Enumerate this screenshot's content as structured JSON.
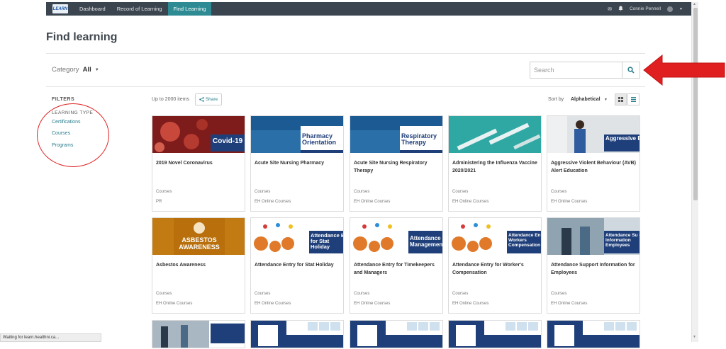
{
  "nav": {
    "logo_text": "LEARN",
    "links": [
      "Dashboard",
      "Record of Learning",
      "Find Learning"
    ],
    "user_name": "Connie Pennell"
  },
  "page": {
    "title": "Find learning"
  },
  "category": {
    "label": "Category",
    "value": "All"
  },
  "search": {
    "placeholder": "Search"
  },
  "filters": {
    "heading": "FILTERS",
    "learning_type_heading": "LEARNING TYPE",
    "types": [
      "Certifications",
      "Courses",
      "Programs"
    ]
  },
  "toolbar": {
    "items_count": "Up to 2000 items",
    "share_label": "Share",
    "sort_label": "Sort by",
    "sort_value": "Alphabetical"
  },
  "cards": [
    {
      "title": "2019 Novel Coronavirus",
      "type": "Courses",
      "source": "PR",
      "banner": "Covid-19"
    },
    {
      "title": "Acute Site Nursing Pharmacy",
      "type": "Courses",
      "source": "EH Online Courses",
      "banner": "Pharmacy Orientation"
    },
    {
      "title": "Acute Site Nursing Respiratory Therapy",
      "type": "Courses",
      "source": "EH Online Courses",
      "banner": "Respiratory Therapy"
    },
    {
      "title": "Administering the Influenza Vaccine 2020/2021",
      "type": "Courses",
      "source": "EH Online Courses",
      "banner": ""
    },
    {
      "title": "Aggressive Violent Behaviour (AVB) Alert Education",
      "type": "Courses",
      "source": "EH Online Courses",
      "banner": "Aggressive Behaviour (A"
    },
    {
      "title": "Asbestos Awareness",
      "type": "Courses",
      "source": "EH Online Courses",
      "banner": "ASBESTOS AWARENESS"
    },
    {
      "title": "Attendance Entry for Stat Holiday",
      "type": "Courses",
      "source": "EH Online Courses",
      "banner": "Attendance E for Stat Holiday"
    },
    {
      "title": "Attendance Entry for Timekeepers and Managers",
      "type": "Courses",
      "source": "EH Online Courses",
      "banner": "Attendance Managemen"
    },
    {
      "title": "Attendance Entry for Worker's Compensation",
      "type": "Courses",
      "source": "EH Online Courses",
      "banner": "Attendance En Workers Compensation"
    },
    {
      "title": "Attendance Support Information for Employees",
      "type": "Courses",
      "source": "EH Online Courses",
      "banner": "Attendance Su - Information Employees"
    }
  ],
  "status_text": "Waiting for learn.healthni.ca...",
  "colors": {
    "nav_bg": "#3b4550",
    "nav_active": "#2e8b93",
    "link": "#2a7f8e",
    "annotation_red": "#e02020"
  }
}
